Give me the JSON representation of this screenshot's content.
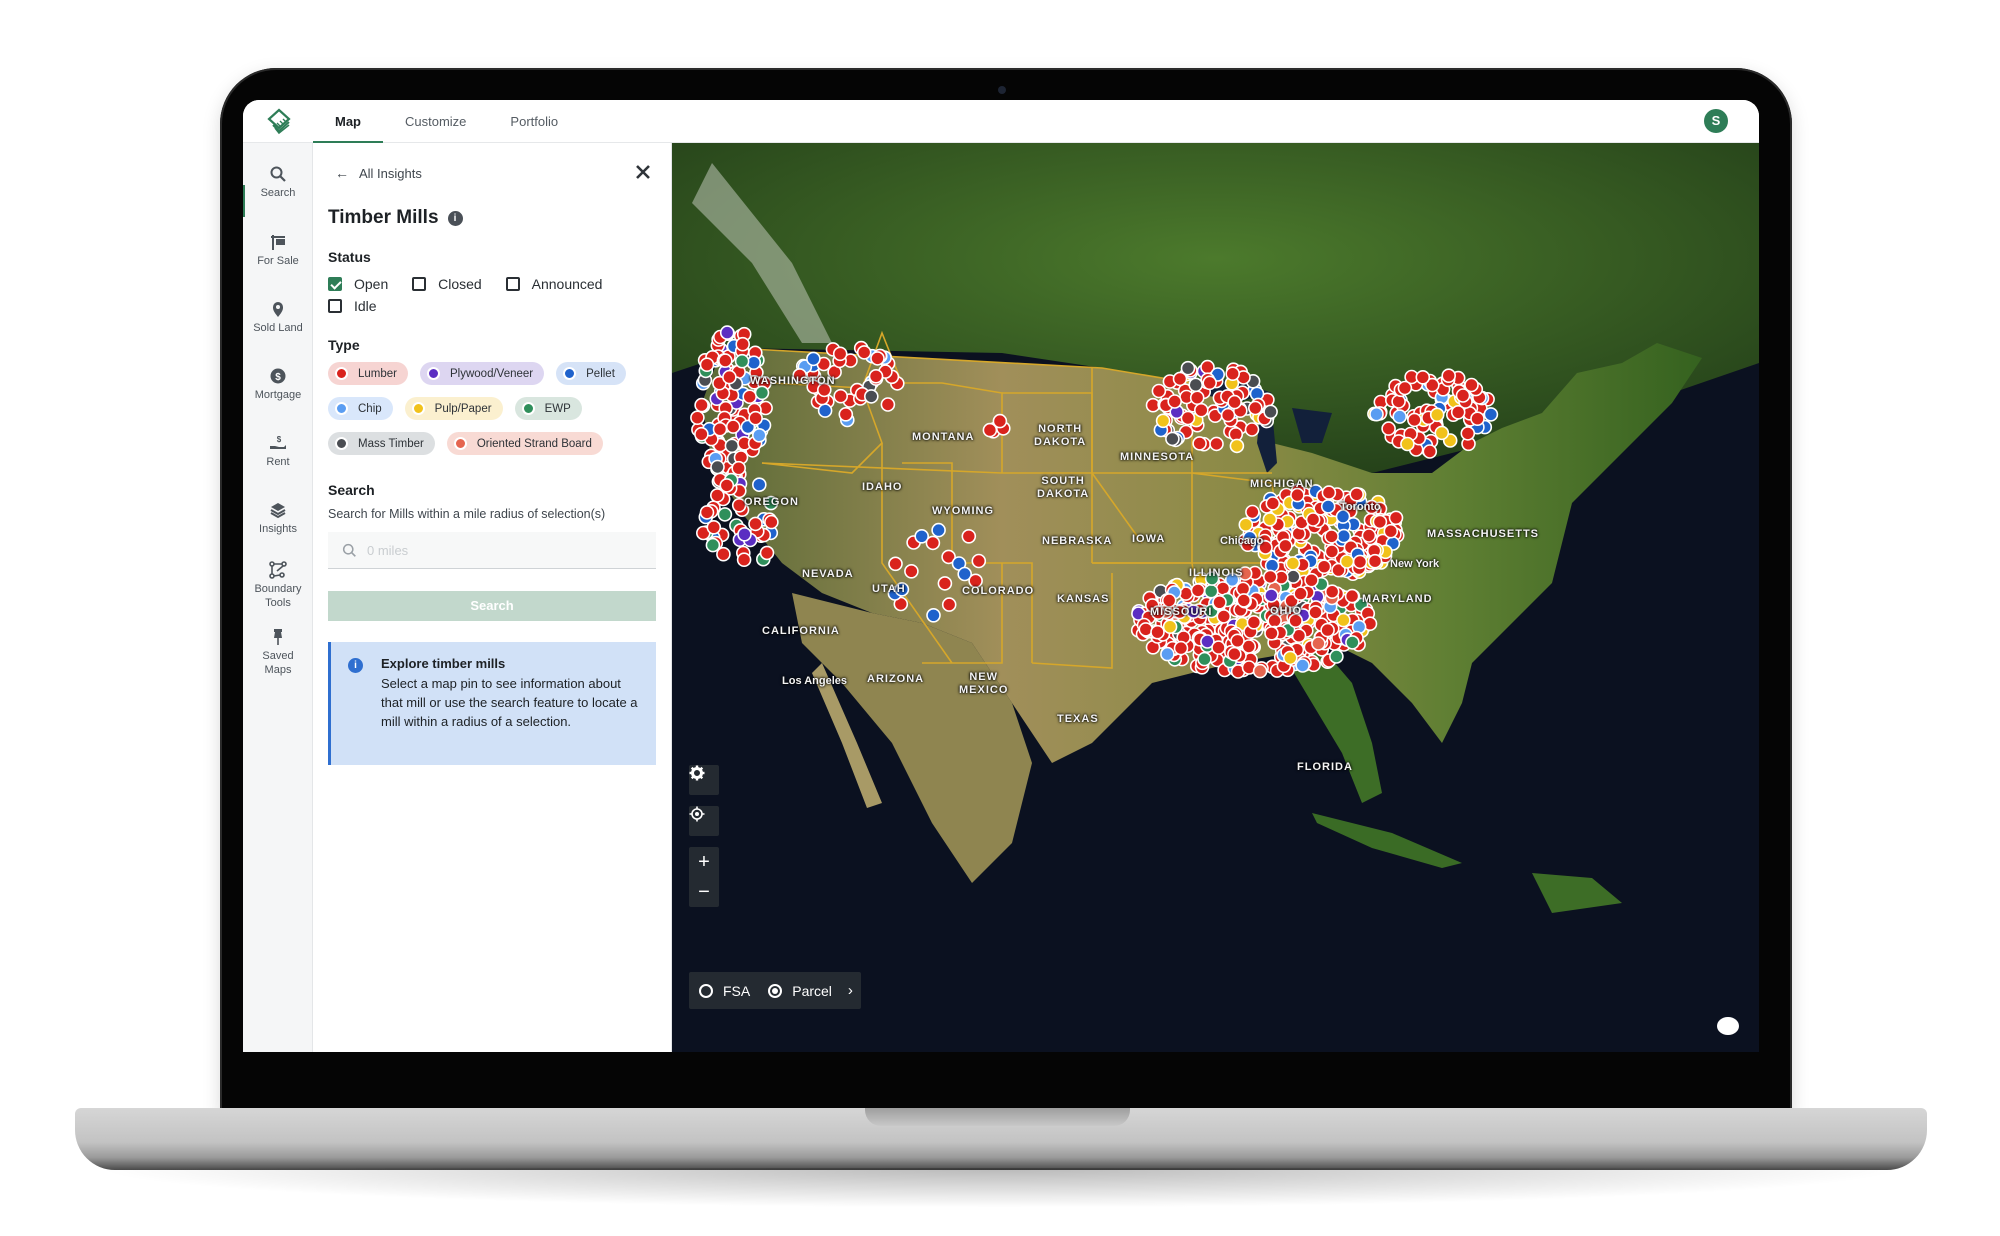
{
  "header": {
    "logo": "layers-logo-icon",
    "tabs": [
      {
        "label": "Map",
        "active": true
      },
      {
        "label": "Customize",
        "active": false
      },
      {
        "label": "Portfolio",
        "active": false
      }
    ],
    "avatar_initial": "S"
  },
  "rail": {
    "items": [
      {
        "label": "Search",
        "icon": "search-icon",
        "active": true
      },
      {
        "label": "For Sale",
        "icon": "sign-icon"
      },
      {
        "label": "Sold Land",
        "icon": "map-pin-icon"
      },
      {
        "label": "Mortgage",
        "icon": "dollar-circle-icon"
      },
      {
        "label": "Rent",
        "icon": "hand-dollar-icon"
      },
      {
        "label": "Insights",
        "icon": "layers-icon"
      },
      {
        "label": "Boundary\nTools",
        "label_lines": [
          "Boundary",
          "Tools"
        ],
        "icon": "polygon-tool-icon"
      },
      {
        "label": "Saved\nMaps",
        "label_lines": [
          "Saved",
          "Maps"
        ],
        "icon": "pushpin-icon"
      }
    ]
  },
  "panel": {
    "back_label": "All Insights",
    "title": "Timber Mills",
    "status_heading": "Status",
    "status_options": [
      {
        "label": "Open",
        "checked": true
      },
      {
        "label": "Closed",
        "checked": false
      },
      {
        "label": "Announced",
        "checked": false
      },
      {
        "label": "Idle",
        "checked": false
      }
    ],
    "type_heading": "Type",
    "types": [
      {
        "label": "Lumber",
        "color": "#d9231d",
        "bg": "#f6d4d2"
      },
      {
        "label": "Plywood/Veneer",
        "color": "#5b2ec2",
        "bg": "#ddd6f1"
      },
      {
        "label": "Pellet",
        "color": "#1f62cc",
        "bg": "#d6e3f7"
      },
      {
        "label": "Chip",
        "color": "#5a9df2",
        "bg": "#d9e7fb"
      },
      {
        "label": "Pulp/Paper",
        "color": "#f1c21b",
        "bg": "#fbf0cf"
      },
      {
        "label": "EWP",
        "color": "#2f8f5b",
        "bg": "#d9e6df"
      },
      {
        "label": "Mass Timber",
        "color": "#4a4d52",
        "bg": "#dcdfe1"
      },
      {
        "label": "Oriented Strand Board",
        "color": "#e5654f",
        "bg": "#f8dad4"
      }
    ],
    "search_heading": "Search",
    "search_hint": "Search for Mills within a mile radius of selection(s)",
    "search_placeholder": "0 miles",
    "search_value": "",
    "search_button": "Search",
    "callout_title": "Explore timber mills",
    "callout_body": "Select a map pin to see information about that mill or use the search feature to locate a mill within a radius of a selection."
  },
  "map": {
    "basemap": "satellite",
    "state_labels": [
      "WASHINGTON",
      "OREGON",
      "IDAHO",
      "MONTANA",
      "WYOMING",
      "NEVADA",
      "UTAH",
      "COLORADO",
      "CALIFORNIA",
      "ARIZONA",
      "NEW\nMEXICO",
      "NORTH\nDAKOTA",
      "SOUTH\nDAKOTA",
      "NEBRASKA",
      "KANSAS",
      "TEXAS",
      "MINNESOTA",
      "IOWA",
      "ILLINOIS",
      "MISSOURI",
      "OHIO",
      "MICHIGAN",
      "FLORIDA",
      "MARYLAND",
      "MASSACHUSETTS"
    ],
    "city_labels": [
      "Los Angeles",
      "Chicago",
      "Toronto",
      "New York"
    ],
    "mill_regions": [
      {
        "region": "Pacific Northwest coast",
        "dominant": [
          "Lumber",
          "Plywood/Veneer",
          "Chip",
          "Mass Timber",
          "EWP",
          "Pellet"
        ],
        "density": "very high"
      },
      {
        "region": "Inland Northwest (ID/MT)",
        "dominant": [
          "Lumber",
          "Chip",
          "Pellet",
          "Mass Timber"
        ],
        "density": "high"
      },
      {
        "region": "Northern California",
        "dominant": [
          "Lumber",
          "Plywood/Veneer",
          "EWP",
          "Pellet"
        ],
        "density": "high"
      },
      {
        "region": "Four Corners (UT/CO/AZ/NM)",
        "dominant": [
          "Lumber",
          "Pellet"
        ],
        "density": "low"
      },
      {
        "region": "Black Hills (SD)",
        "dominant": [
          "Lumber"
        ],
        "density": "low"
      },
      {
        "region": "Great Lakes (MN/WI/MI)",
        "dominant": [
          "Lumber",
          "Pulp/Paper",
          "Plywood/Veneer",
          "Mass Timber",
          "Pellet"
        ],
        "density": "high"
      },
      {
        "region": "Northeast (NY/New England)",
        "dominant": [
          "Lumber",
          "Chip",
          "Pellet",
          "Pulp/Paper"
        ],
        "density": "high"
      },
      {
        "region": "Appalachia / Mid-Atlantic",
        "dominant": [
          "Lumber",
          "Pellet",
          "Pulp/Paper"
        ],
        "density": "very high"
      },
      {
        "region": "Southeast / Gulf Coast",
        "dominant": [
          "Lumber",
          "Chip",
          "Pulp/Paper",
          "Oriented Strand Board",
          "Plywood/Veneer",
          "EWP",
          "Mass Timber"
        ],
        "density": "very high"
      }
    ]
  },
  "map_controls": {
    "settings": "gear-icon",
    "locate": "crosshair-icon",
    "zoom_in": "+",
    "zoom_out": "−",
    "layers": [
      {
        "label": "FSA",
        "selected": false
      },
      {
        "label": "Parcel",
        "selected": true
      }
    ]
  }
}
